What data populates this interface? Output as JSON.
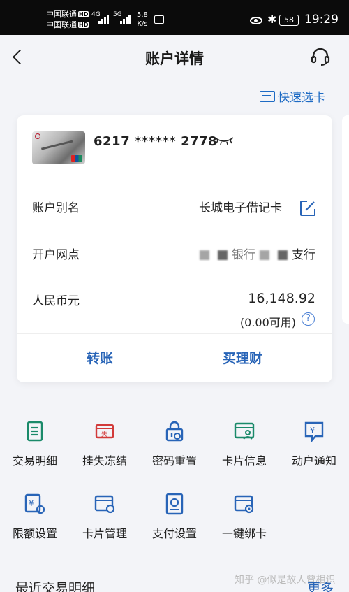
{
  "status_bar": {
    "carrier_1": "中国联通",
    "carrier_2": "中国联通",
    "hd_badge": "HD",
    "net_1": "4G",
    "net_2": "5G",
    "speed_value": "5.8",
    "speed_unit": "K/s",
    "battery": "58",
    "time": "19:29"
  },
  "header": {
    "title": "账户详情"
  },
  "quick_select": {
    "label": "快速选卡"
  },
  "account": {
    "card_number": "6217 ****** 2778",
    "alias_label": "账户别名",
    "alias_value": "长城电子借记卡",
    "branch_label": "开户网点",
    "branch_value_visible_1": "银行",
    "branch_value_visible_2": "支行",
    "currency_label": "人民币元",
    "balance": "16,148.92",
    "available": "(0.00可用)",
    "help_symbol": "?"
  },
  "actions": {
    "transfer": "转账",
    "wealth": "买理财"
  },
  "services": [
    {
      "label": "交易明细",
      "icon": "transaction-detail-icon",
      "color": "#1a8a6a"
    },
    {
      "label": "挂失冻结",
      "icon": "report-loss-icon",
      "color": "#d23a3a"
    },
    {
      "label": "密码重置",
      "icon": "password-reset-icon",
      "color": "#2864b7"
    },
    {
      "label": "卡片信息",
      "icon": "card-info-icon",
      "color": "#1a8a6a"
    },
    {
      "label": "动户通知",
      "icon": "account-notice-icon",
      "color": "#2864b7"
    },
    {
      "label": "限额设置",
      "icon": "limit-setting-icon",
      "color": "#2864b7"
    },
    {
      "label": "卡片管理",
      "icon": "card-manage-icon",
      "color": "#2864b7"
    },
    {
      "label": "支付设置",
      "icon": "payment-setting-icon",
      "color": "#2864b7"
    },
    {
      "label": "一键绑卡",
      "icon": "bind-card-icon",
      "color": "#2864b7"
    }
  ],
  "recent": {
    "title": "最近交易明细",
    "more": "更多"
  },
  "watermark": "知乎 @似是故人曾相识",
  "colors": {
    "accent_blue": "#2864b7",
    "green": "#1a8a6a",
    "red": "#d23a3a",
    "background": "#f3f4f8"
  }
}
